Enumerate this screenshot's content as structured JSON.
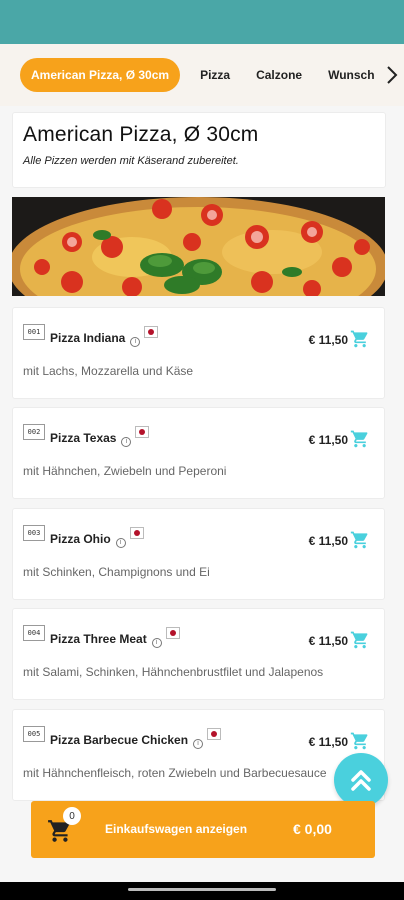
{
  "tabs": [
    {
      "label": "American Pizza, Ø 30cm",
      "active": true
    },
    {
      "label": "Pizza"
    },
    {
      "label": "Calzone"
    },
    {
      "label": "Wunsch"
    }
  ],
  "category": {
    "title": "American Pizza, Ø 30cm",
    "subtitle": "Alle Pizzen werden mit Käserand zubereitet."
  },
  "items": [
    {
      "number": "001",
      "name": "Pizza Indiana",
      "price": "€ 11,50",
      "description": "mit Lachs, Mozzarella und Käse"
    },
    {
      "number": "002",
      "name": "Pizza Texas",
      "price": "€ 11,50",
      "description": "mit Hähnchen, Zwiebeln und Peperoni"
    },
    {
      "number": "003",
      "name": "Pizza Ohio",
      "price": "€ 11,50",
      "description": "mit Schinken, Champignons und Ei"
    },
    {
      "number": "004",
      "name": "Pizza Three Meat",
      "price": "€ 11,50",
      "description": "mit Salami, Schinken, Hähnchenbrustfilet und Jalapenos"
    },
    {
      "number": "005",
      "name": "Pizza Barbecue Chicken",
      "price": "€ 11,50",
      "description": "mit Hähnchenfleisch, roten Zwiebeln und Barbecuesauce"
    }
  ],
  "cart": {
    "count": "0",
    "label": "Einkaufswagen anzeigen",
    "total": "€ 0,00"
  },
  "colors": {
    "accent": "#f7a21b",
    "teal": "#4aa7a7",
    "cart_icon": "#4ad0dd"
  },
  "icons": {
    "cart": "shopping-cart-icon",
    "scroll_top": "double-chevron-up-icon",
    "info": "info-icon",
    "flag": "japan-flag-icon",
    "tab_next": "chevron-right-icon"
  }
}
